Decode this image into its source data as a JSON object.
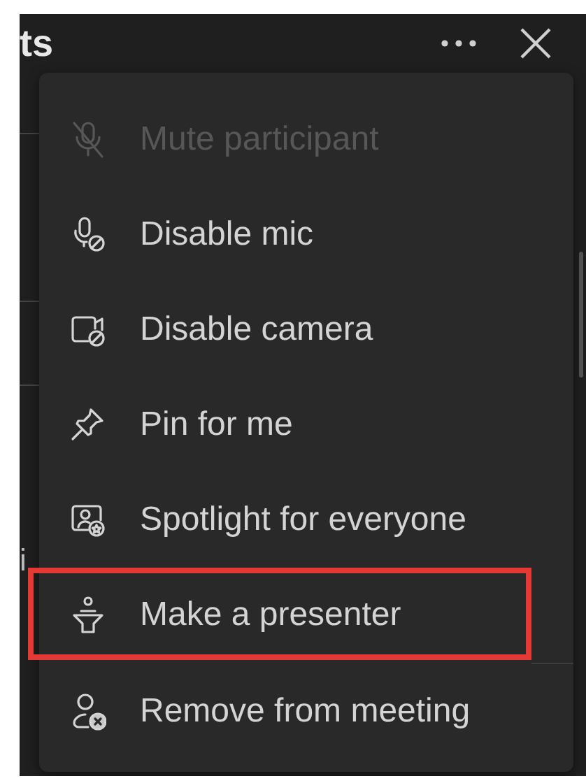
{
  "panel": {
    "title": "ts",
    "background_fragments": [
      "i"
    ]
  },
  "menu": {
    "items": [
      {
        "kind": "mute",
        "label": "Mute participant",
        "disabled": true,
        "highlighted": false
      },
      {
        "kind": "mic",
        "label": "Disable mic",
        "disabled": false,
        "highlighted": false
      },
      {
        "kind": "camera",
        "label": "Disable camera",
        "disabled": false,
        "highlighted": false
      },
      {
        "kind": "pin",
        "label": "Pin for me",
        "disabled": false,
        "highlighted": false
      },
      {
        "kind": "spotlight",
        "label": "Spotlight for everyone",
        "disabled": false,
        "highlighted": false
      },
      {
        "kind": "presenter",
        "label": "Make a presenter",
        "disabled": false,
        "highlighted": true
      },
      {
        "kind": "remove",
        "label": "Remove from meeting",
        "disabled": false,
        "highlighted": false
      }
    ]
  }
}
